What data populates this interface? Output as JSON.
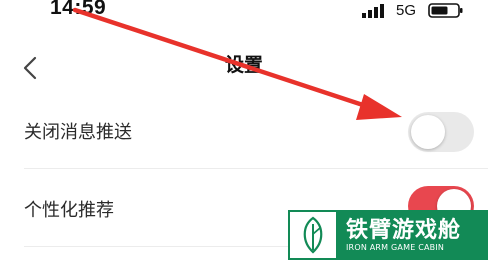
{
  "status_bar": {
    "time": "14:59",
    "network": "5G"
  },
  "nav": {
    "title": "设置",
    "back_icon": "chevron-left-icon"
  },
  "settings": [
    {
      "label": "关闭消息推送",
      "toggle": "off"
    },
    {
      "label": "个性化推荐",
      "toggle": "on"
    }
  ],
  "colors": {
    "toggle_on": "#e8474f",
    "toggle_off": "#e9e9e9",
    "arrow": "#e8322b",
    "watermark_bg": "#128a56"
  },
  "watermark": {
    "title": "铁臂游戏舱",
    "subtitle": "IRON ARM GAME CABIN",
    "icon": "leaf-logo-icon"
  }
}
